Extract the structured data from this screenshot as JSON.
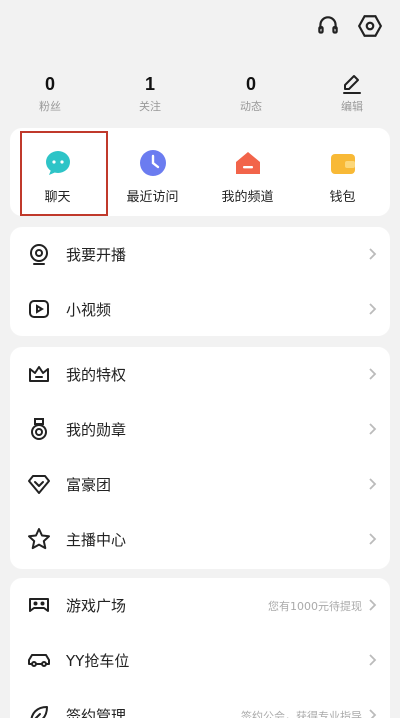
{
  "stats": [
    {
      "value": "0",
      "label": "粉丝"
    },
    {
      "value": "1",
      "label": "关注"
    },
    {
      "value": "0",
      "label": "动态"
    },
    {
      "label": "编辑"
    }
  ],
  "quick": [
    {
      "label": "聊天",
      "icon": "chat-icon",
      "color": "#2ec4c7"
    },
    {
      "label": "最近访问",
      "icon": "clock-icon",
      "color": "#6b7cf0"
    },
    {
      "label": "我的频道",
      "icon": "home-icon",
      "color": "#f2644a"
    },
    {
      "label": "钱包",
      "icon": "wallet-icon",
      "color": "#f8b936"
    }
  ],
  "menu1": [
    {
      "label": "我要开播",
      "icon": "camera-icon"
    },
    {
      "label": "小视频",
      "icon": "play-icon"
    }
  ],
  "menu2": [
    {
      "label": "我的特权",
      "icon": "crown-icon"
    },
    {
      "label": "我的勋章",
      "icon": "medal-icon"
    },
    {
      "label": "富豪团",
      "icon": "diamond-icon"
    },
    {
      "label": "主播中心",
      "icon": "star-icon"
    }
  ],
  "menu3": [
    {
      "label": "游戏广场",
      "icon": "gamepad-icon",
      "hint": "您有1000元待提现"
    },
    {
      "label": "YY抢车位",
      "icon": "car-icon"
    },
    {
      "label": "签约管理",
      "icon": "leaf-icon",
      "hint": "签约公会，获得专业指导"
    }
  ]
}
